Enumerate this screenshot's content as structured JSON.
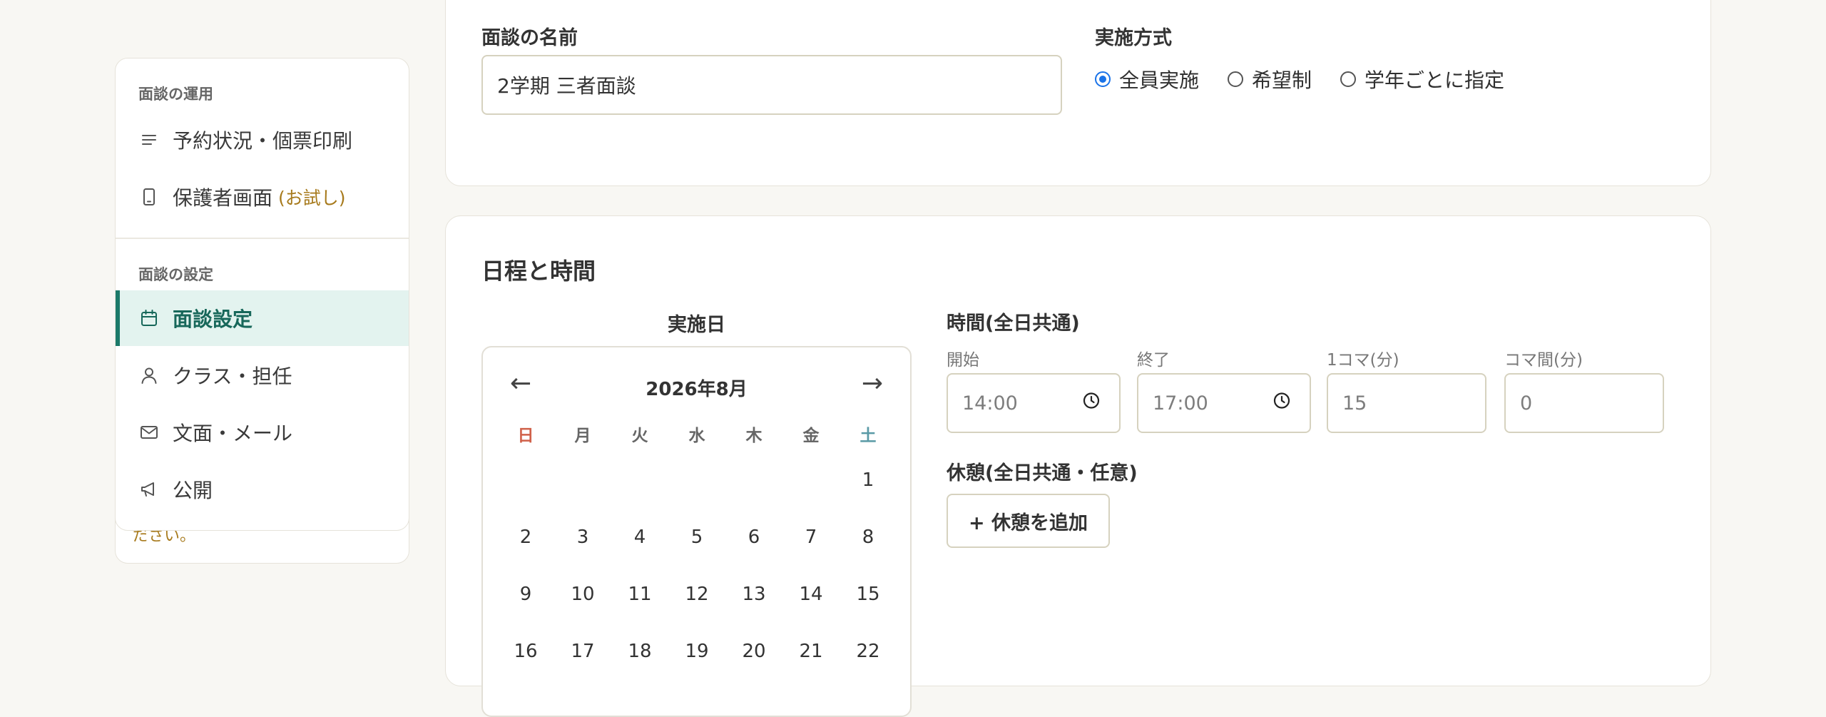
{
  "sidebar": {
    "section_operation": "面談の運用",
    "section_settings": "面談の設定",
    "items": [
      {
        "label": "予約状況・個票印刷",
        "icon": "list-icon"
      },
      {
        "label": "保護者画面",
        "suffix": "(お試し)",
        "icon": "phone-icon"
      },
      {
        "label": "面談設定",
        "icon": "calendar-icon",
        "active": true
      },
      {
        "label": "クラス・担任",
        "icon": "user-icon"
      },
      {
        "label": "文面・メール",
        "icon": "mail-icon"
      },
      {
        "label": "公開",
        "icon": "megaphone-icon"
      }
    ],
    "behind_text": "ださい。"
  },
  "form": {
    "name_label": "面談の名前",
    "name_value": "2学期 三者面談",
    "method_label": "実施方式",
    "methods": [
      {
        "label": "全員実施",
        "selected": true
      },
      {
        "label": "希望制",
        "selected": false
      },
      {
        "label": "学年ごとに指定",
        "selected": false
      }
    ]
  },
  "schedule": {
    "title": "日程と時間",
    "date_label": "実施日",
    "calendar": {
      "prev": "←",
      "next": "→",
      "month": "2026年8月",
      "weekdays": [
        "日",
        "月",
        "火",
        "水",
        "木",
        "金",
        "土"
      ],
      "weeks": [
        [
          "",
          "",
          "",
          "",
          "",
          "",
          "1"
        ],
        [
          "2",
          "3",
          "4",
          "5",
          "6",
          "7",
          "8"
        ],
        [
          "9",
          "10",
          "11",
          "12",
          "13",
          "14",
          "15"
        ],
        [
          "16",
          "17",
          "18",
          "19",
          "20",
          "21",
          "22"
        ]
      ]
    },
    "time_label": "時間(全日共通)",
    "start_label": "開始",
    "start_value": "14:00",
    "end_label": "終了",
    "end_value": "17:00",
    "slot_label": "1コマ(分)",
    "slot_value": "15",
    "gap_label": "コマ間(分)",
    "gap_value": "0",
    "break_label": "休憩(全日共通・任意)",
    "add_break_button": "+ 休憩を追加"
  },
  "colors": {
    "accent": "#1c7a69",
    "active_bg": "#e3f3ef",
    "radio": "#1a73e8",
    "sunday": "#d0614a",
    "saturday": "#5a9aa6",
    "trial": "#a77a1c"
  }
}
